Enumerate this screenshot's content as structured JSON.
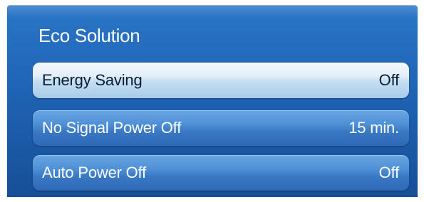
{
  "menu": {
    "title": "Eco Solution",
    "items": [
      {
        "label": "Energy Saving",
        "value": "Off",
        "selected": true
      },
      {
        "label": "No Signal Power Off",
        "value": "15 min.",
        "selected": false
      },
      {
        "label": "Auto Power Off",
        "value": "Off",
        "selected": false
      }
    ]
  },
  "colors": {
    "panel": "#1f63b4",
    "item_normal": "#4e8fd6",
    "item_selected": "#c6dff2",
    "text_light": "#ffffff",
    "text_dark": "#0b1d33"
  }
}
